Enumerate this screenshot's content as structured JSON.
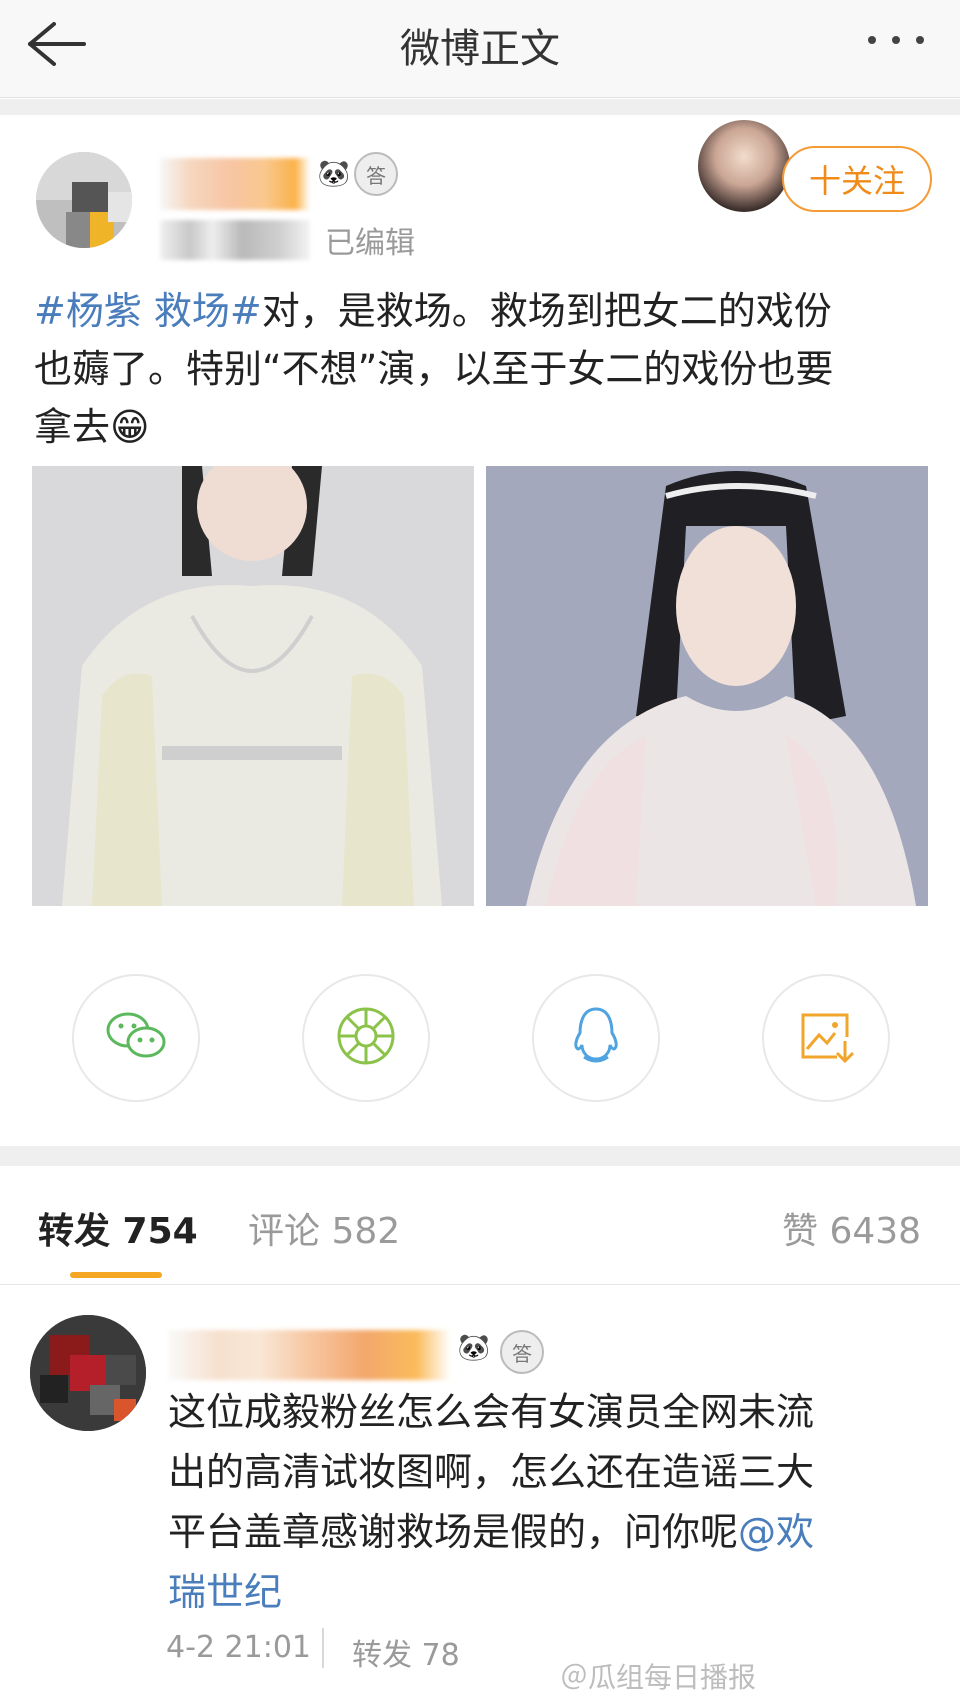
{
  "header": {
    "title": "微博正文"
  },
  "post": {
    "edited_label": "已编辑",
    "follow_label": "十关注",
    "hashtag": "#杨紫 救场#",
    "text_line1": "对，是救场。救场到把女二的戏份",
    "text_line2": "也薅了。特别“不想”演，以至于女二的戏份也要",
    "text_line3": "拿去",
    "emoji": "😁"
  },
  "share_icons": [
    "wechat-icon",
    "moments-icon",
    "qq-icon",
    "save-image-icon"
  ],
  "tabs": {
    "repost": "转发 754",
    "comment": "评论 582",
    "like": "赞 6438"
  },
  "comment": {
    "text_line1": "这位成毅粉丝怎么会有女演员全网未流",
    "text_line2": "出的高清试妆图啊，怎么还在造谣三大",
    "text_line3": "平台盖章感谢救场是假的，问你呢",
    "mention_part1": "@欢",
    "mention_part2": "瑞世纪",
    "time": "4-2 21:01",
    "repost": "转发 78"
  },
  "watermark": "＠瓜组每日播报",
  "colors": {
    "accent_orange": "#f5a623",
    "link_blue": "#4a7dbb",
    "follow_orange": "#f08a18"
  }
}
